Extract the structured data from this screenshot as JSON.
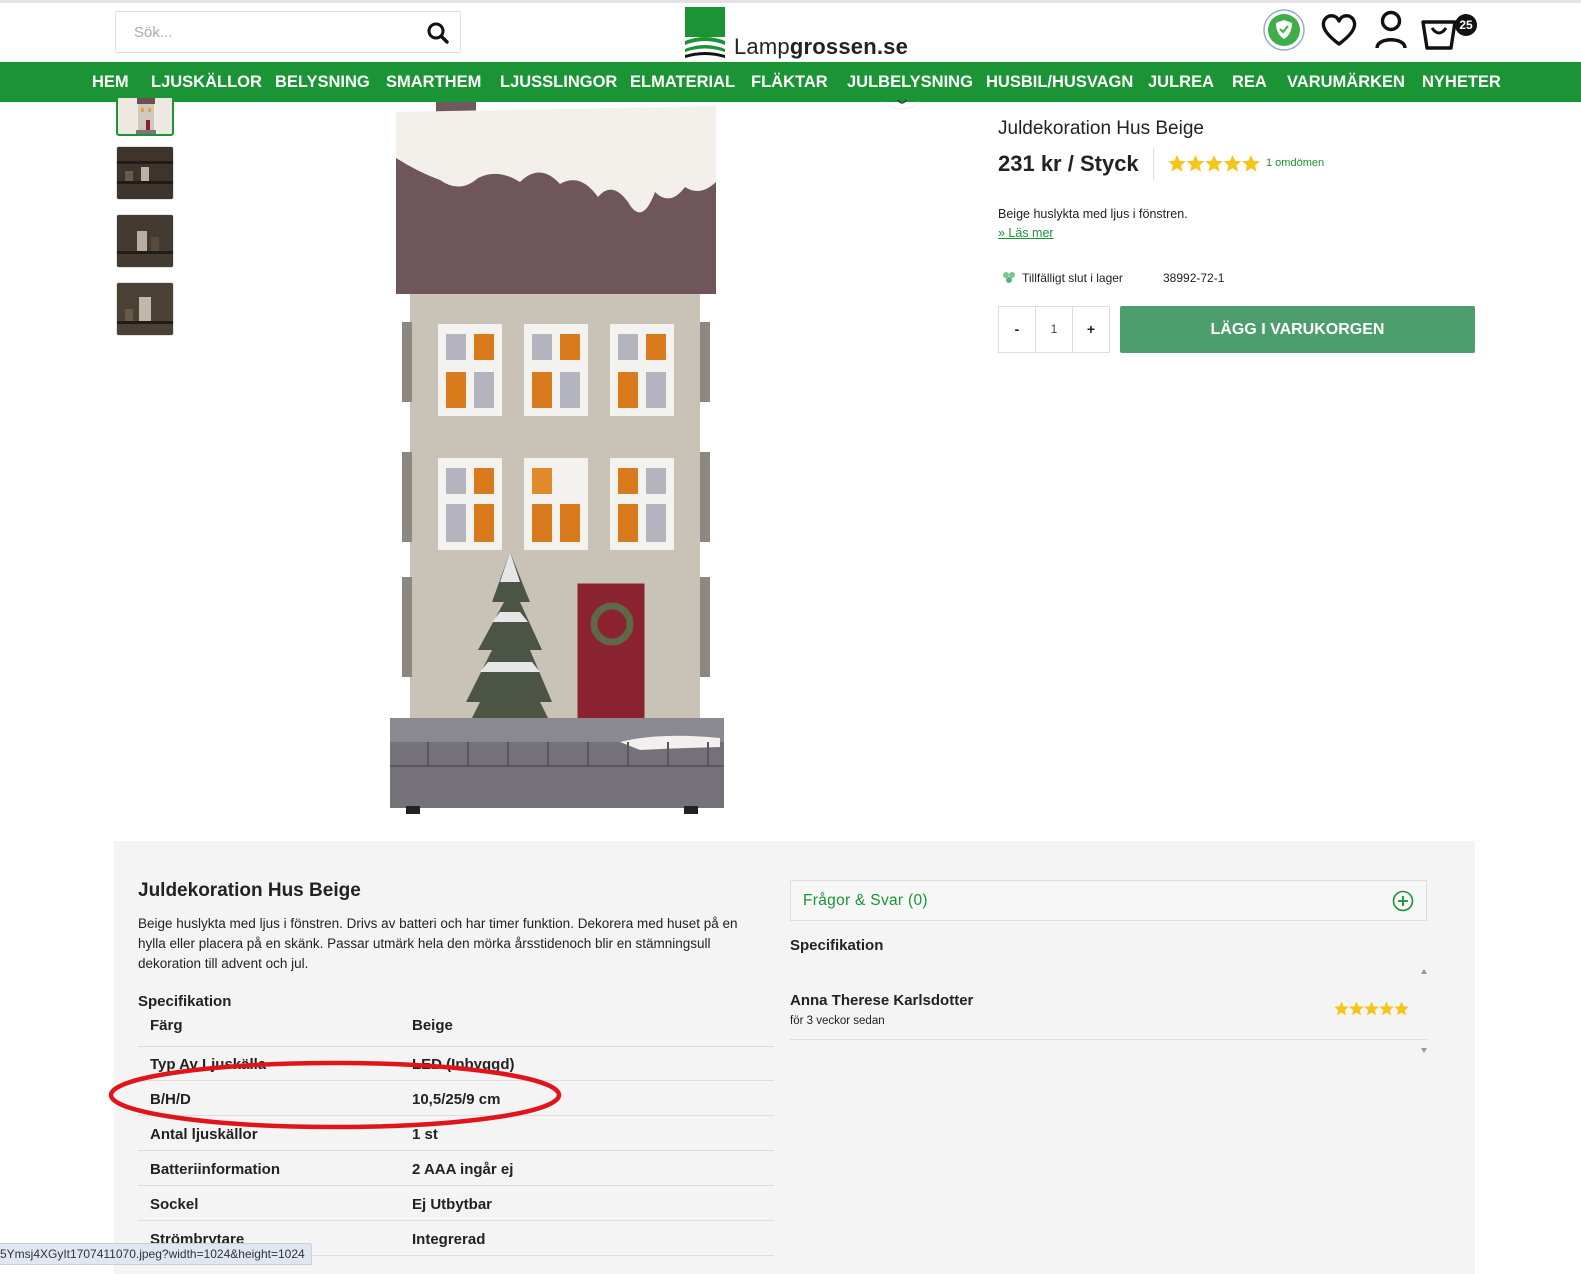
{
  "header": {
    "search_placeholder": "Sök...",
    "brand_light": "Lamp",
    "brand_bold": "grossen.se",
    "cart_count": "25",
    "trust_badge_icon": "trygg-e-handel-badge-icon"
  },
  "nav": {
    "items": [
      "HEM",
      "LJUSKÄLLOR",
      "BELYSNING",
      "SMARTHEM",
      "LJUSSLINGOR",
      "ELMATERIAL",
      "FLÄKTAR",
      "JULBELYSNING",
      "HUSBIL/HUSVAGN",
      "JULREA",
      "REA",
      "VARUMÄRKEN",
      "NYHETER"
    ]
  },
  "product": {
    "title": "Juldekoration Hus Beige",
    "price": "231 kr / Styck",
    "rating": 5,
    "reviews_label": "1 omdömen",
    "short_description": "Beige huslykta med ljus i fönstren.",
    "read_more": "» Läs mer",
    "stock_status": "Tillfälligt slut i lager",
    "sku": "38992-72-1",
    "quantity": "1",
    "qty_minus": "-",
    "qty_plus": "+",
    "add_to_cart": "LÄGG I VARUKORGEN"
  },
  "details": {
    "title": "Juldekoration Hus Beige",
    "description": "Beige huslykta med ljus i fönstren. Drivs av batteri och har timer funktion. Dekorera med huset på en hylla eller placera på en skänk. Passar utmärk hela den mörka årsstidenoch blir en stämningsull dekoration till advent och jul.",
    "spec_heading": "Specifikation",
    "specs": [
      {
        "key": "Färg",
        "value": "Beige"
      },
      {
        "key": "Typ Av Ljuskälla",
        "value": "LED (Inbyggd)"
      },
      {
        "key": "B/H/D",
        "value": "10,5/25/9 cm"
      },
      {
        "key": "Antal ljuskällor",
        "value": "1 st"
      },
      {
        "key": "Batteriinformation",
        "value": "2 AAA ingår ej"
      },
      {
        "key": "Sockel",
        "value": "Ej Utbytbar"
      },
      {
        "key": "Strömbrytare",
        "value": "Integrerad"
      }
    ],
    "faq_label": "Frågor & Svar (0)",
    "right_spec_heading": "Specifikation",
    "review": {
      "name": "Anna Therese Karlsdotter",
      "time": "för 3 veckor sedan",
      "rating": 5
    }
  },
  "status_bar": "5Ymsj4XGyIt1707411070.jpeg?width=1024&height=1024",
  "colors": {
    "brand_green": "#1a9434",
    "cart_button": "#4c9e6c",
    "star": "#f5c518",
    "annotation_red": "#e0141b"
  }
}
